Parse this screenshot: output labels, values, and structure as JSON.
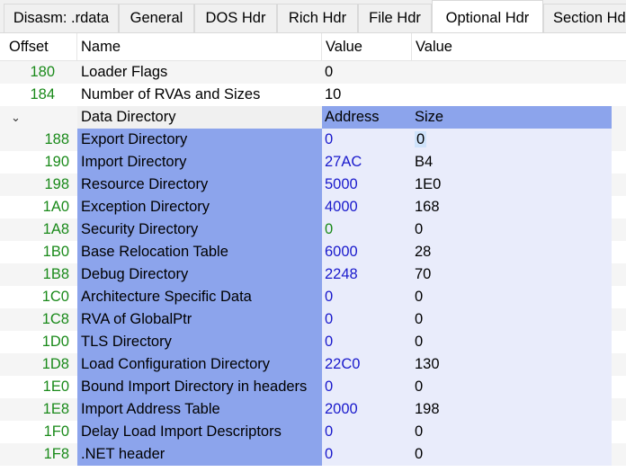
{
  "tabs": [
    {
      "label": "Disasm: .rdata",
      "active": false
    },
    {
      "label": "General",
      "active": false
    },
    {
      "label": "DOS Hdr",
      "active": false
    },
    {
      "label": "Rich Hdr",
      "active": false
    },
    {
      "label": "File Hdr",
      "active": false
    },
    {
      "label": "Optional Hdr",
      "active": true
    },
    {
      "label": "Section Hd",
      "active": false
    }
  ],
  "columns": {
    "offset": "Offset",
    "name": "Name",
    "value1": "Value",
    "value2": "Value"
  },
  "rows_top": [
    {
      "offset": "180",
      "name": "Loader Flags",
      "value": "0"
    },
    {
      "offset": "184",
      "name": "Number of RVAs and Sizes",
      "value": "10"
    }
  ],
  "data_directory": {
    "name": "Data Directory",
    "address_header": "Address",
    "size_header": "Size",
    "expand_icon": "chevron-down-icon"
  },
  "directories": [
    {
      "offset": "188",
      "name": "Export Directory",
      "address": "0",
      "size": "0"
    },
    {
      "offset": "190",
      "name": "Import Directory",
      "address": "27AC",
      "size": "B4"
    },
    {
      "offset": "198",
      "name": "Resource Directory",
      "address": "5000",
      "size": "1E0"
    },
    {
      "offset": "1A0",
      "name": "Exception Directory",
      "address": "4000",
      "size": "168"
    },
    {
      "offset": "1A8",
      "name": "Security Directory",
      "address": "0",
      "size": "0"
    },
    {
      "offset": "1B0",
      "name": "Base Relocation Table",
      "address": "6000",
      "size": "28"
    },
    {
      "offset": "1B8",
      "name": "Debug Directory",
      "address": "2248",
      "size": "70"
    },
    {
      "offset": "1C0",
      "name": "Architecture Specific Data",
      "address": "0",
      "size": "0"
    },
    {
      "offset": "1C8",
      "name": "RVA of GlobalPtr",
      "address": "0",
      "size": "0"
    },
    {
      "offset": "1D0",
      "name": "TLS Directory",
      "address": "0",
      "size": "0"
    },
    {
      "offset": "1D8",
      "name": "Load Configuration Directory",
      "address": "22C0",
      "size": "130"
    },
    {
      "offset": "1E0",
      "name": "Bound Import Directory in headers",
      "address": "0",
      "size": "0"
    },
    {
      "offset": "1E8",
      "name": "Import Address Table",
      "address": "2000",
      "size": "198"
    },
    {
      "offset": "1F0",
      "name": "Delay Load Import Descriptors",
      "address": "0",
      "size": "0"
    },
    {
      "offset": "1F8",
      "name": ".NET header",
      "address": "0",
      "size": "0"
    }
  ],
  "colors": {
    "offset_text": "#1a8a1a",
    "address_text": "#1a1acc",
    "selection": "#8ca4ec"
  }
}
